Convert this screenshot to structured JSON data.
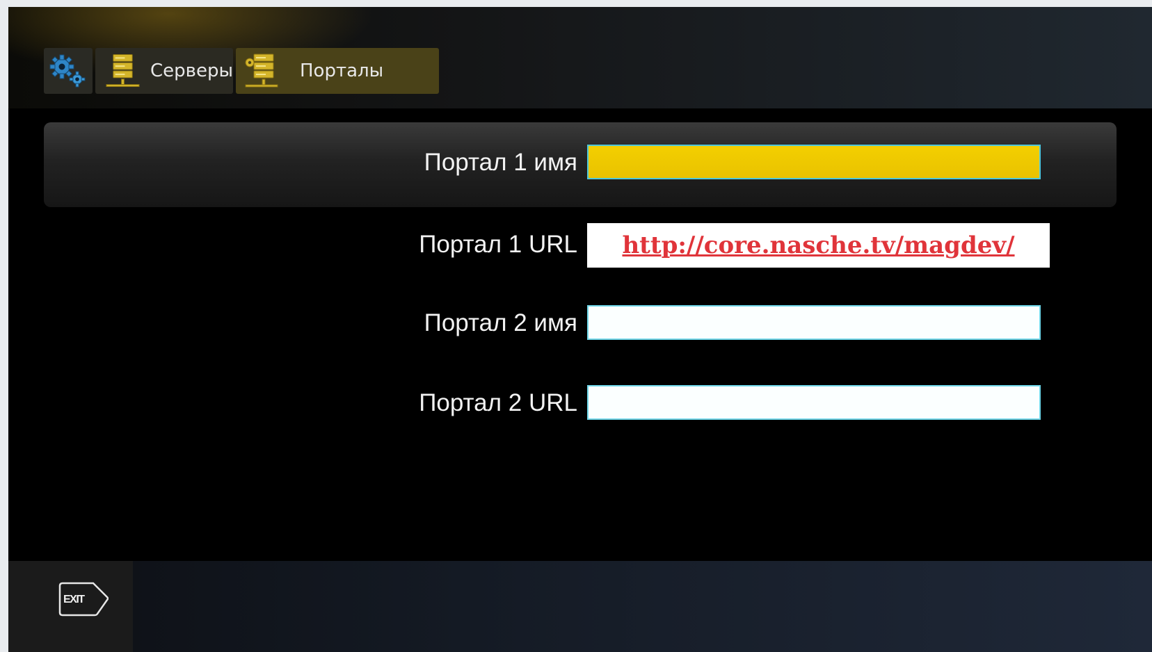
{
  "breadcrumb": {
    "items": [
      {
        "icon": "gears-icon",
        "label": ""
      },
      {
        "icon": "server-icon",
        "label": "Серверы"
      },
      {
        "icon": "server-settings-icon",
        "label": "Порталы"
      }
    ]
  },
  "form": {
    "rows": [
      {
        "label": "Портал 1 имя",
        "value": "",
        "focused": true
      },
      {
        "label": "Портал 1 URL",
        "value": ""
      },
      {
        "label": "Портал 2 имя",
        "value": ""
      },
      {
        "label": "Портал 2 URL",
        "value": ""
      }
    ]
  },
  "overlay": {
    "url_link": "http://core.nasche.tv/magdev/"
  },
  "footer": {
    "exit_label": "EXIT"
  },
  "colors": {
    "focus_field": "#f3cf00",
    "field_border": "#6fd6e8",
    "link_red": "#e0343a",
    "server_icon": "#d4b52a",
    "gear_icon": "#2e86c8"
  }
}
